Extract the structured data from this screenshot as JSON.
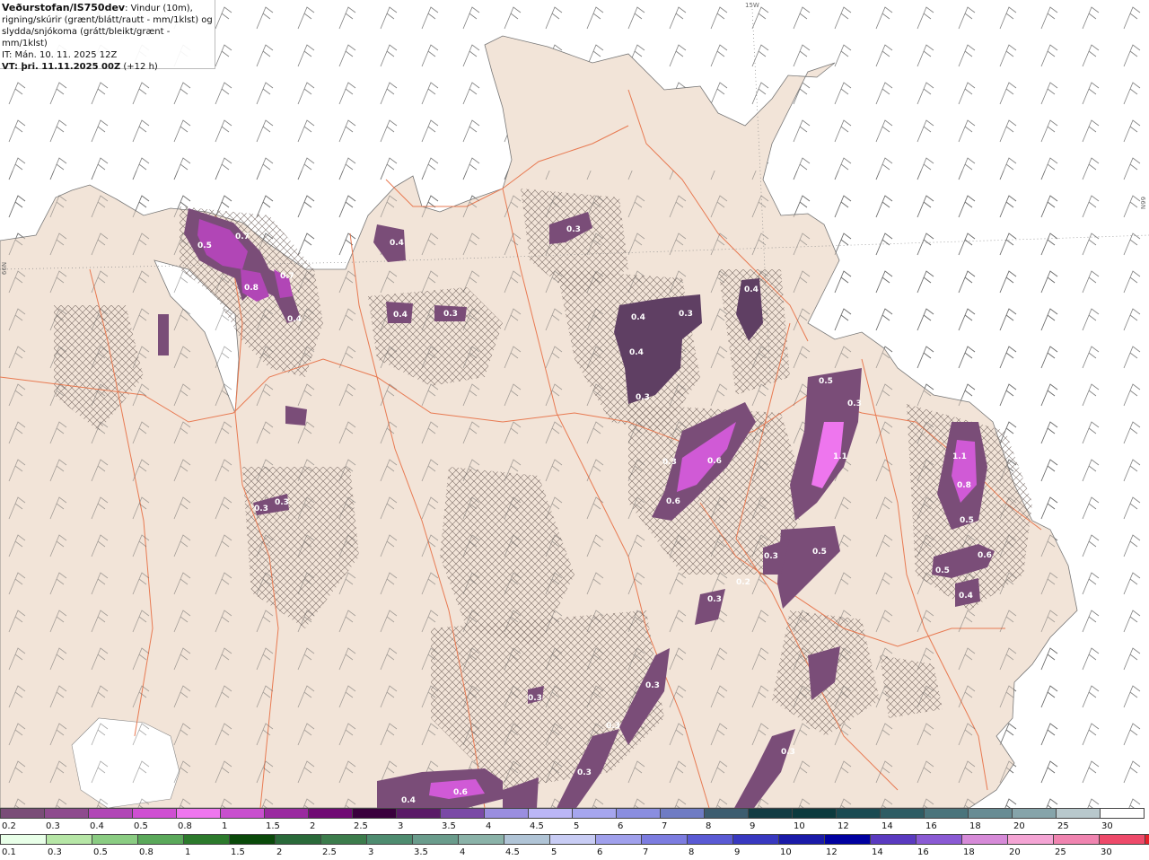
{
  "header": {
    "title": "Veðurstofan/IS750dev",
    "desc_line1": ": Vindur (10m),",
    "desc_line2": "rigning/skúrir (grænt/blátt/rautt - mm/1klst) og",
    "desc_line3": "slydda/snjókoma (grátt/bleikt/grænt - mm/1klst)",
    "it": "IT: Mán. 10. 11. 2025 12Z",
    "vt_label": "VT: þri. 11.11.2025 00Z",
    "vt_offset": "(+12 h)"
  },
  "grid_labels": {
    "lon_15w": "15W",
    "lat_66n_right": "66N",
    "lat_66n_left": "66N"
  },
  "precip_labels": [
    "0.5",
    "0.7",
    "0.7",
    "0.8",
    "0.4",
    "0.4",
    "0.4",
    "0.3",
    "0.3",
    "0.4",
    "0.3",
    "0.4",
    "0.4",
    "0.3",
    "0.3",
    "0.3",
    "0.5",
    "0.3",
    "1.1",
    "0.6",
    "0.6",
    "0.3",
    "1.1",
    "0.8",
    "0.5",
    "0.5",
    "0.6",
    "0.4",
    "0.5",
    "0.3",
    "0.2",
    "0.3",
    "0.3",
    "0.3",
    "0.3",
    "0.3",
    "0.3",
    "0.4",
    "0.6"
  ],
  "legend_snow": {
    "labels": [
      "0.2",
      "0.3",
      "0.4",
      "0.5",
      "0.8",
      "1",
      "1.5",
      "2",
      "2.5",
      "3",
      "3.5",
      "4",
      "4.5",
      "5",
      "6",
      "7",
      "8",
      "9",
      "10",
      "12",
      "14",
      "16",
      "18",
      "20",
      "25",
      "30"
    ],
    "colors": [
      "#7a4d78",
      "#8e4b8e",
      "#b146b6",
      "#cf4fd2",
      "#ee76ee",
      "#c84fce",
      "#9a2aa0",
      "#700a74",
      "#3a003d",
      "#5a1a67",
      "#7a4aa6",
      "#9a8ee0",
      "#bbb6f6",
      "#a6a6ee",
      "#8a8ee0",
      "#6f7cc4",
      "#3d5d70",
      "#123c44",
      "#0c3a3e",
      "#1a4a52",
      "#2e5c64",
      "#4a747c",
      "#688c94",
      "#86a4aa",
      "#b8c8cc",
      "#ffffff"
    ]
  },
  "legend_rain": {
    "labels": [
      "0.1",
      "0.3",
      "0.5",
      "0.8",
      "1",
      "1.5",
      "2",
      "2.5",
      "3",
      "3.5",
      "4",
      "4.5",
      "5",
      "6",
      "7",
      "8",
      "9",
      "10",
      "12",
      "14",
      "16",
      "18",
      "20",
      "25",
      "30"
    ],
    "colors": [
      "#e8ffe8",
      "#b6e6a6",
      "#8acc82",
      "#5aa85a",
      "#2c7a2c",
      "#0a4a0a",
      "#2a6a3a",
      "#3c7c4c",
      "#4e8c70",
      "#6a9c8c",
      "#8ab2a8",
      "#b0c4d6",
      "#c8ccf4",
      "#a0a0ec",
      "#7c7ce0",
      "#5a5ad4",
      "#3838c0",
      "#1a1aa8",
      "#0000a0",
      "#5a3ac0",
      "#8a5ad4",
      "#d68ad8",
      "#f4a4d4",
      "#f084b0",
      "#ee4a6a",
      "#e8202a"
    ]
  }
}
